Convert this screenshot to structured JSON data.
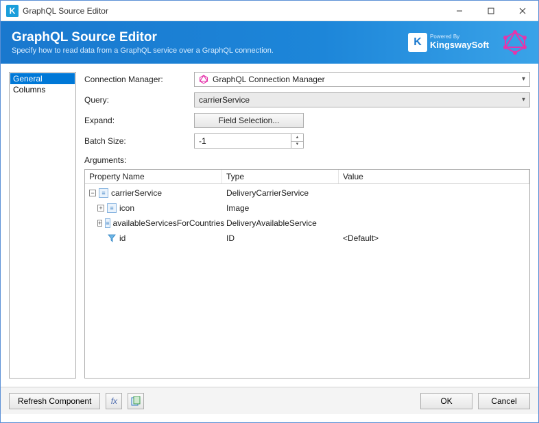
{
  "titlebar": {
    "text": "GraphQL Source Editor"
  },
  "header": {
    "title": "GraphQL Source Editor",
    "subtitle": "Specify how to read data from a GraphQL service over a GraphQL connection.",
    "brand_powered": "Powered By",
    "brand_name": "KingswaySoft"
  },
  "sidebar": {
    "items": [
      {
        "label": "General",
        "selected": true
      },
      {
        "label": "Columns",
        "selected": false
      }
    ]
  },
  "form": {
    "connection_label": "Connection Manager:",
    "connection_value": "GraphQL Connection Manager",
    "query_label": "Query:",
    "query_value": "carrierService",
    "expand_label": "Expand:",
    "field_selection_btn": "Field Selection...",
    "batch_size_label": "Batch Size:",
    "batch_size_value": "-1",
    "arguments_label": "Arguments:"
  },
  "tree": {
    "headers": {
      "name": "Property Name",
      "type": "Type",
      "value": "Value"
    },
    "rows": [
      {
        "level": 0,
        "expanded": true,
        "icon": "struct",
        "name": "carrierService",
        "type": "DeliveryCarrierService",
        "value": ""
      },
      {
        "level": 1,
        "expanded": false,
        "icon": "struct",
        "name": "icon",
        "type": "Image",
        "value": ""
      },
      {
        "level": 1,
        "expanded": false,
        "icon": "struct",
        "name": "availableServicesForCountries",
        "type": "DeliveryAvailableService",
        "value": ""
      },
      {
        "level": 1,
        "expanded": null,
        "icon": "funnel",
        "name": "id",
        "type": "ID",
        "value": "<Default>"
      }
    ]
  },
  "footer": {
    "refresh": "Refresh Component",
    "ok": "OK",
    "cancel": "Cancel"
  }
}
